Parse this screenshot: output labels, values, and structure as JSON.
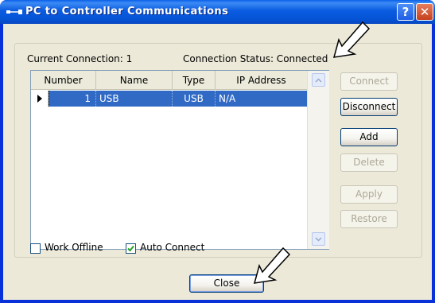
{
  "window": {
    "title": "PC to Controller Communications",
    "help_label": "?",
    "close_label": "✕"
  },
  "status": {
    "current_connection": "Current Connection: 1",
    "connection_status": "Connection Status: Connected"
  },
  "grid": {
    "columns": [
      "Number",
      "Name",
      "Type",
      "IP Address"
    ],
    "rows": [
      {
        "number": "1",
        "name": "USB",
        "type": "USB",
        "ip": "N/A",
        "selected": true
      }
    ]
  },
  "buttons": {
    "connect": "Connect",
    "disconnect": "Disconnect",
    "add": "Add",
    "delete": "Delete",
    "apply": "Apply",
    "restore": "Restore",
    "close": "Close"
  },
  "checkboxes": {
    "work_offline": {
      "label": "Work Offline",
      "checked": false
    },
    "auto_connect": {
      "label": "Auto Connect",
      "checked": true
    }
  },
  "colors": {
    "title_bar": "#0a5be0",
    "selection": "#316ac5",
    "dialog_bg": "#ece9d8"
  }
}
